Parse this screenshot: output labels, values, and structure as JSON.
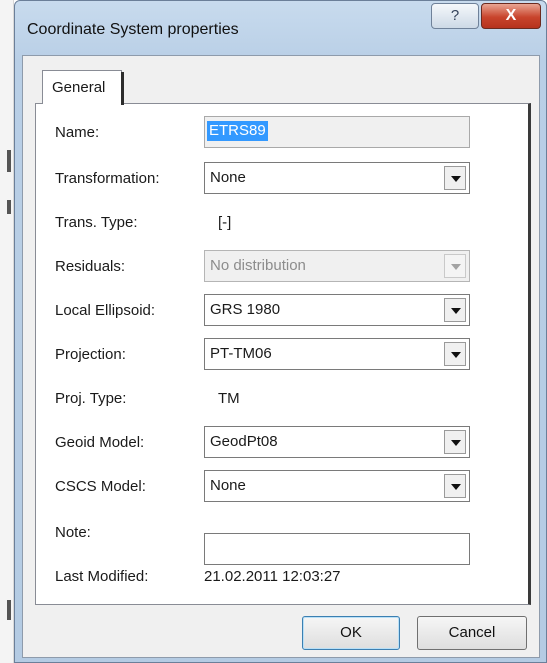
{
  "window": {
    "title": "Coordinate System properties",
    "help_glyph": "?",
    "close_glyph": "X"
  },
  "tabs": [
    {
      "label": "General",
      "selected": true
    }
  ],
  "form": {
    "name": {
      "label": "Name:",
      "value": "ETRS89"
    },
    "transformation": {
      "label": "Transformation:",
      "value": "None"
    },
    "trans_type": {
      "label": "Trans. Type:",
      "value": "[-]"
    },
    "residuals": {
      "label": "Residuals:",
      "value": "No distribution",
      "enabled": false
    },
    "local_ellipsoid": {
      "label": "Local Ellipsoid:",
      "value": "GRS 1980"
    },
    "projection": {
      "label": "Projection:",
      "value": "PT-TM06"
    },
    "proj_type": {
      "label": "Proj. Type:",
      "value": "TM"
    },
    "geoid_model": {
      "label": "Geoid Model:",
      "value": "GeodPt08"
    },
    "cscs_model": {
      "label": "CSCS Model:",
      "value": "None"
    },
    "note": {
      "label": "Note:",
      "value": ""
    },
    "last_modified": {
      "label": "Last Modified:",
      "value": "21.02.2011 12:03:27"
    }
  },
  "buttons": {
    "ok": "OK",
    "cancel": "Cancel"
  },
  "colors": {
    "titlebar": "#b9cfe6",
    "close": "#c8442c",
    "selection": "#3399ff"
  }
}
